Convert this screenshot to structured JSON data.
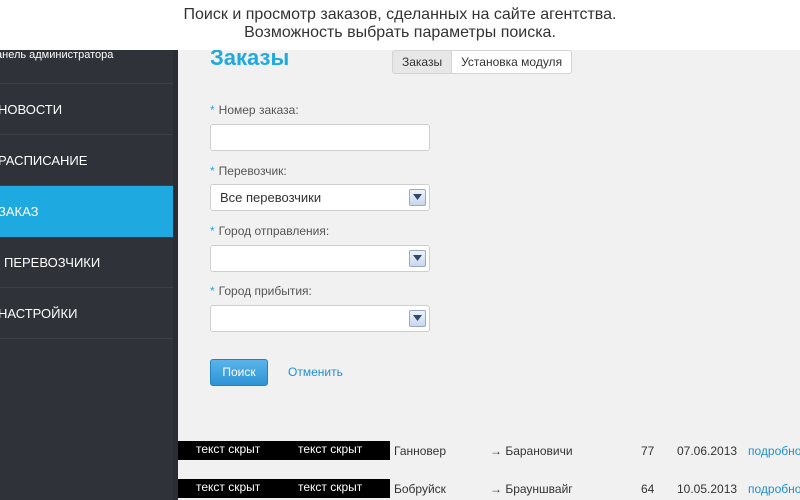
{
  "caption": {
    "line1": "Поиск и просмотр заказов, сделанных на сайте агентства.",
    "line2": "Возможность выбрать параметры поиска."
  },
  "sidebar": {
    "header": "анель администратора",
    "items": [
      {
        "label": "НОВОСТИ",
        "active": false
      },
      {
        "label": "РАСПИСАНИЕ",
        "active": false
      },
      {
        "label": "ЗАКАЗ",
        "active": true
      },
      {
        "label": "ПЕРЕВОЗЧИКИ",
        "active": false
      },
      {
        "label": "НАСТРОЙКИ",
        "active": false
      }
    ]
  },
  "main": {
    "title": "Заказы",
    "tabs": [
      {
        "label": "Заказы",
        "active": true
      },
      {
        "label": "Установка модуля",
        "active": false
      }
    ],
    "form": {
      "order_number_label": "Номер заказа:",
      "order_number_value": "",
      "carrier_label": "Перевозчик:",
      "carrier_value": "Все перевозчики",
      "departure_label": "Город отправления:",
      "departure_value": "",
      "arrival_label": "Город прибытия:",
      "arrival_value": "",
      "required_mark": "*",
      "search_button": "Поиск",
      "cancel_link": "Отменить"
    },
    "results": [
      {
        "hidden1": "текст скрыт",
        "hidden2": "текст скрыт",
        "from": "Ганновер",
        "to": "→ Барановичи",
        "count": "77",
        "date": "07.06.2013",
        "more": "подробно"
      },
      {
        "hidden1": "текст скрыт",
        "hidden2": "текст скрыт",
        "from": "Бобруйск",
        "to": "→ Брауншвайг",
        "count": "64",
        "date": "10.05.2013",
        "more": "подробно"
      }
    ]
  },
  "colors": {
    "accent": "#1fa9e1",
    "sidebar_bg": "#2f3238",
    "link": "#1f8fd0"
  }
}
